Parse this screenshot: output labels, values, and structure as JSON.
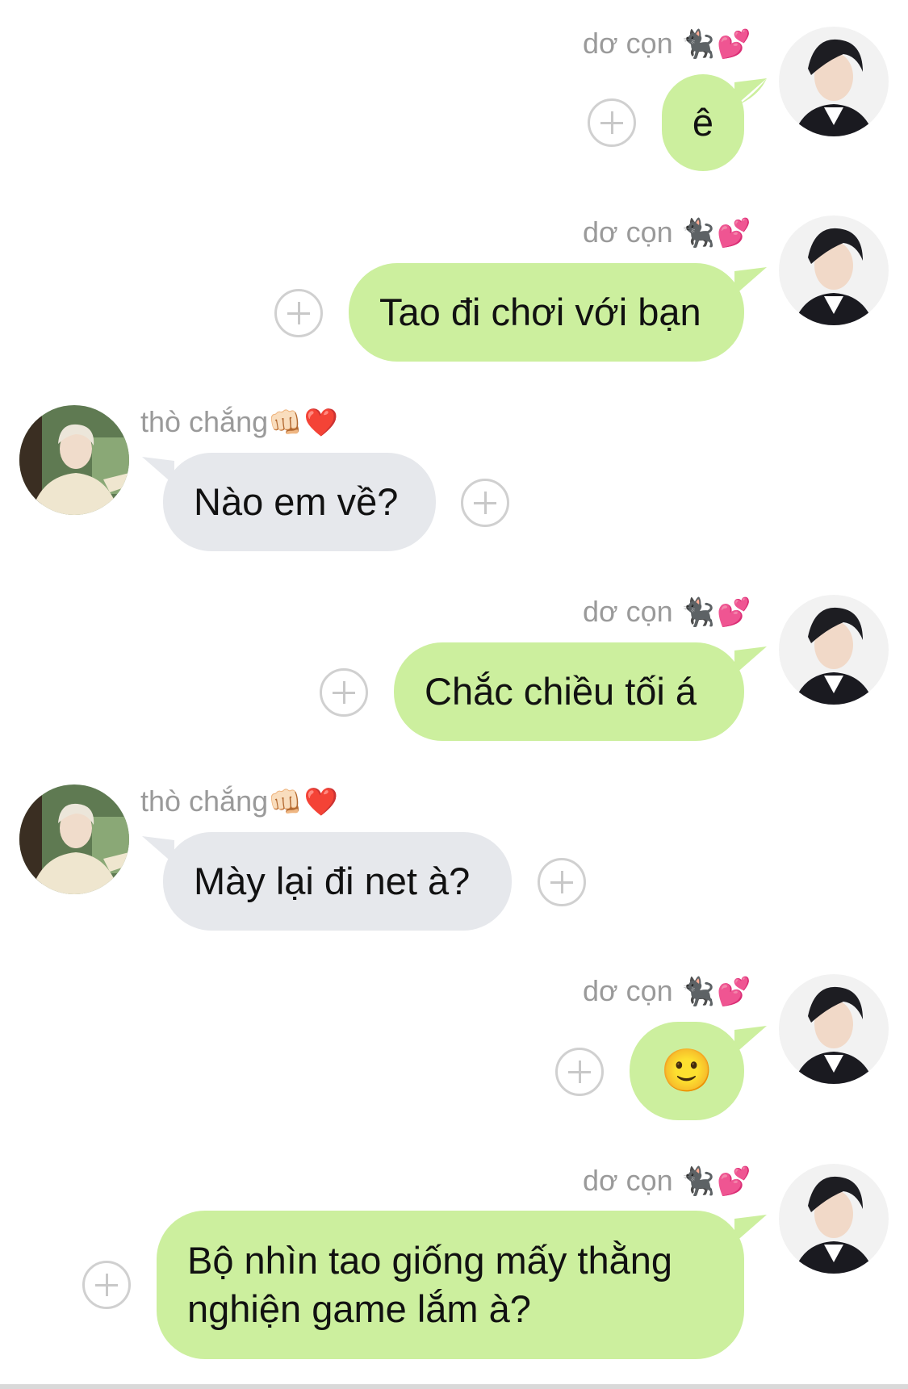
{
  "users": {
    "self": {
      "name": "dơ cọn",
      "name_emoji": "🐈‍⬛💕"
    },
    "other": {
      "name": "thò chắng",
      "name_emoji": "👊🏻❤️"
    }
  },
  "colors": {
    "outgoing_bubble": "#ccef9e",
    "incoming_bubble": "#e6e8ec",
    "name_text": "#9a9a9a"
  },
  "messages": [
    {
      "sender": "self",
      "text": "ê"
    },
    {
      "sender": "self",
      "text": "Tao đi chơi với bạn"
    },
    {
      "sender": "other",
      "text": "Nào em về?"
    },
    {
      "sender": "self",
      "text": "Chắc chiều tối á"
    },
    {
      "sender": "other",
      "text": "Mày lại đi net à?"
    },
    {
      "sender": "self",
      "text": "🙂"
    },
    {
      "sender": "self",
      "text": "Bộ nhìn tao giống mấy thằng nghiện game lắm à?"
    }
  ],
  "icons": {
    "add_reaction": "plus-circle-icon"
  }
}
